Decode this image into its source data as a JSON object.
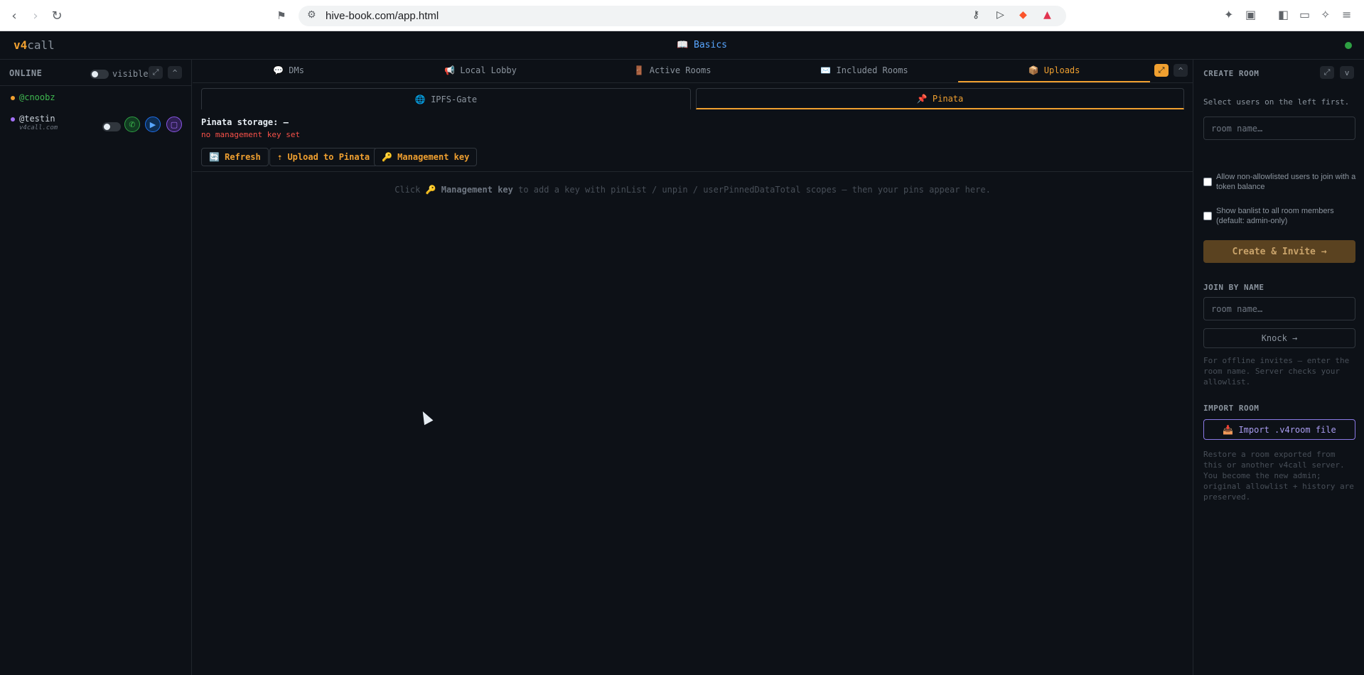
{
  "browser": {
    "url": "hive-book.com/app.html",
    "back_icon": "‹",
    "forward_icon": "›",
    "reload_icon": "↻",
    "bookmark_icon": "⚑"
  },
  "app": {
    "brand_a": "v4",
    "brand_b": "call",
    "center_link": "📖 Basics"
  },
  "left": {
    "title": "ONLINE",
    "visible_label": "visible",
    "expand": "⤢",
    "collapse": "^",
    "users": [
      {
        "name": "@cnoobz",
        "color": "#f0a030"
      },
      {
        "name": "@testin",
        "domain": "v4call.com",
        "color": "#a371f7"
      }
    ]
  },
  "tabs": [
    {
      "label": "💬 DMs"
    },
    {
      "label": "📢 Local Lobby"
    },
    {
      "label": "🚪 Active Rooms"
    },
    {
      "label": "✉️ Included Rooms"
    },
    {
      "label": "📦 Uploads"
    }
  ],
  "tab_buttons": {
    "expand": "⤢",
    "collapse": "^"
  },
  "subtabs": [
    {
      "label": "🌐 IPFS-Gate"
    },
    {
      "label": "📌 Pinata"
    }
  ],
  "pinata": {
    "storage": "Pinata storage: —",
    "status": "no management key set",
    "refresh": "🔄 Refresh",
    "upload": "⇡ Upload to Pinata",
    "mgmt_key": "🔑 Management key",
    "hint_pre": "Click 🔑",
    "hint_key": "Management key",
    "hint_post": "to add a key with pinList / unpin / userPinnedDataTotal scopes — then your pins appear here."
  },
  "right": {
    "create_title": "CREATE ROOM",
    "expand": "⤢",
    "collapse": "v",
    "select_text": "Select users on the left first.",
    "room_placeholder": "room name…",
    "allow_label": "Allow non-allowlisted users to join with a token balance",
    "banlist_label": "Show banlist to all room members (default: admin-only)",
    "create_btn": "Create & Invite →",
    "join_title": "JOIN BY NAME",
    "join_placeholder": "room name…",
    "knock_btn": "Knock →",
    "join_help": "For offline invites — enter the room name. Server checks your allowlist.",
    "import_title": "IMPORT ROOM",
    "import_btn": "📥 Import .v4room file",
    "import_help": "Restore a room exported from this or another v4call server. You become the new admin; original allowlist + history are preserved."
  },
  "colors": {
    "accent": "#f0a030",
    "bg": "#0d1117",
    "online": "#2ea043"
  }
}
